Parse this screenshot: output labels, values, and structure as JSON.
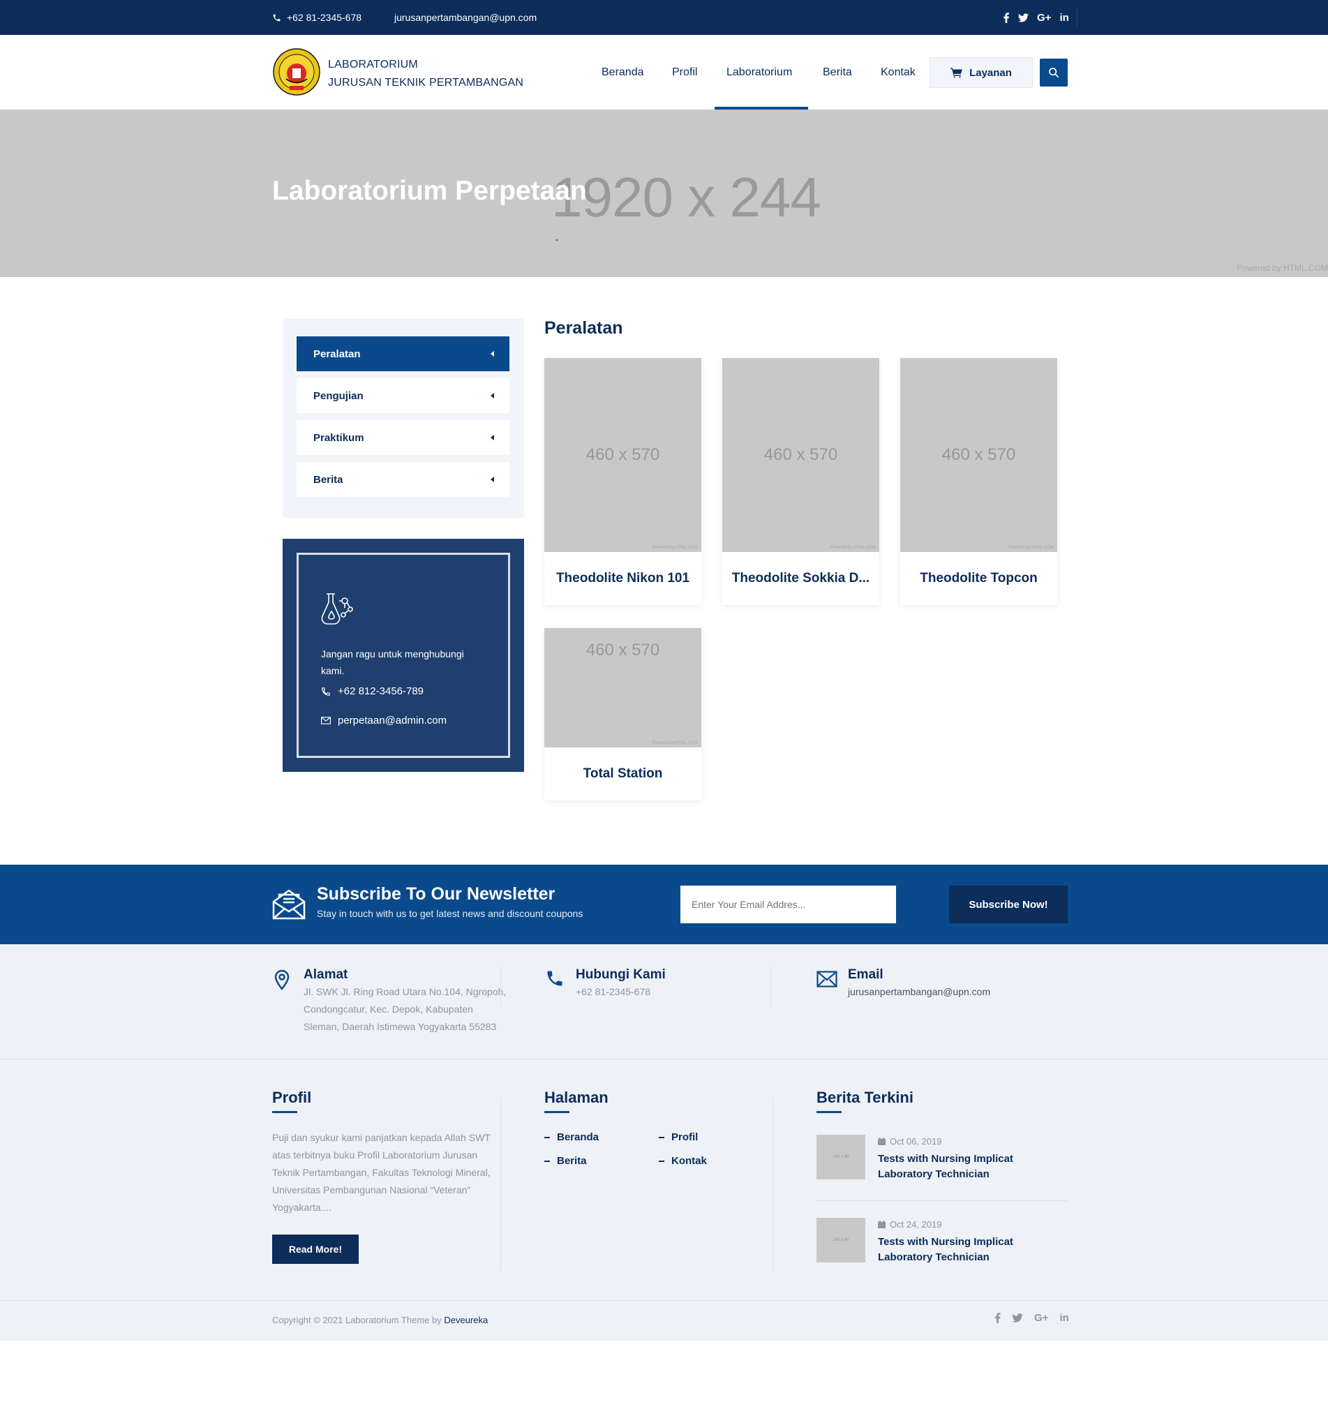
{
  "topbar": {
    "phone": "+62 81-2345-678",
    "email": "jurusanpertambangan@upn.com",
    "social": [
      "facebook-icon",
      "twitter-icon",
      "google-plus-icon",
      "linkedin-icon"
    ],
    "gplus_label": "G+",
    "linkedin_label": "in"
  },
  "header": {
    "brand_line1": "LABORATORIUM",
    "brand_line2": "JURUSAN TEKNIK PERTAMBANGAN",
    "nav": [
      "Beranda",
      "Profil",
      "Laboratorium",
      "Berita",
      "Kontak"
    ],
    "active_nav": "Laboratorium",
    "layanan_label": "Layanan"
  },
  "hero": {
    "title": "Laboratorium Perpetaan",
    "placeholder": "1920 x 244",
    "powered": "Powered by HTML.COM"
  },
  "sidebar": {
    "items": [
      "Peralatan",
      "Pengujian",
      "Praktikum",
      "Berita"
    ],
    "active": "Peralatan",
    "contact_text": "Jangan ragu untuk menghubungi kami.",
    "contact_phone": "+62 812-3456-789",
    "contact_email": "perpetaan@admin.com"
  },
  "content": {
    "title": "Peralatan",
    "image_placeholder": "460 x 570",
    "image_powered": "Powered by HTML.COM",
    "items": [
      "Theodolite Nikon 101",
      "Theodolite Sokkia D...",
      "Theodolite Topcon",
      "Total Station"
    ]
  },
  "newsletter": {
    "title": "Subscribe To Our Newsletter",
    "subtitle": "Stay in touch with us to get latest news and discount coupons",
    "placeholder": "Enter Your Email Addres...",
    "button": "Subscribe Now!"
  },
  "footer": {
    "address_title": "Alamat",
    "address_lines": [
      "Jl. SWK Jl. Ring Road Utara No.104, Ngropoh,",
      "Condongcatur, Kec. Depok, Kabupaten",
      "Sleman, Daerah Istimewa Yogyakarta 55283"
    ],
    "phone_title": "Hubungi Kami",
    "phone": "+62 81-2345-678",
    "email_title": "Email",
    "email": "jurusanpertambangan@upn.com",
    "profil_title": "Profil",
    "profil_text": "Puji dan syukur kami panjatkan kepada Allah SWT atas terbitnya buku Profil Laboratorium Jurusan Teknik Pertambangan, Fakultas Teknologi Mineral, Universitas Pembangunan Nasional “Veteran” Yogyakarta....",
    "read_more": "Read More!",
    "halaman_title": "Halaman",
    "halaman_links": [
      "Beranda",
      "Profil",
      "Berita",
      "Kontak"
    ],
    "berita_title": "Berita Terkini",
    "news": [
      {
        "date": "Oct 06, 2019",
        "title": "Tests with Nursing Implicat Laboratory Technician"
      },
      {
        "date": "Oct 24, 2019",
        "title": "Tests with Nursing Implicat Laboratory Technician"
      }
    ],
    "thumb_placeholder": "100 x 95",
    "copyright_prefix": "Copyright © 2021 Laboratorium Theme by",
    "copyright_brand": "Deveureka"
  },
  "colors": {
    "navy": "#0c2d5a",
    "blue": "#0a4a8c",
    "sidebar_box": "#1f3f6e",
    "placeholder_gray": "#c8c8c8"
  }
}
